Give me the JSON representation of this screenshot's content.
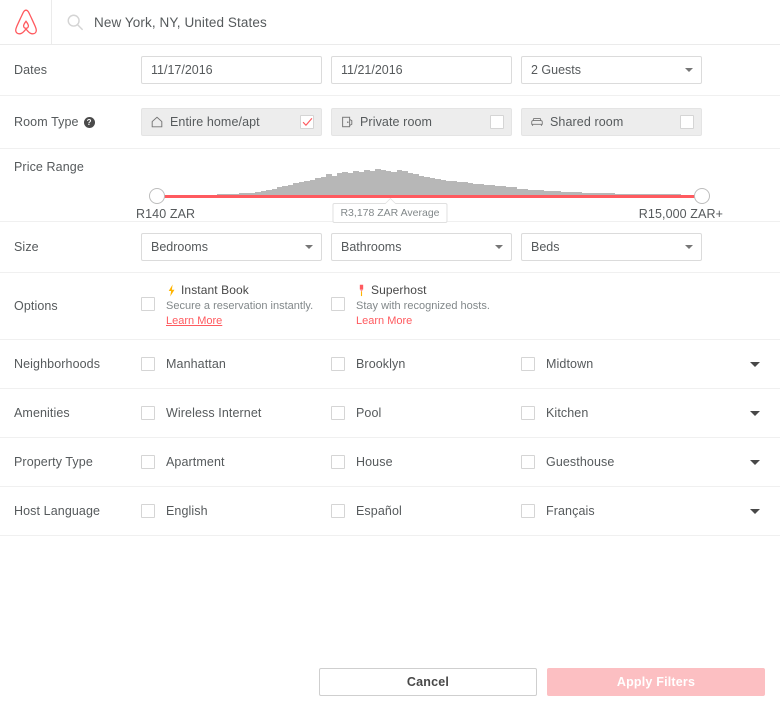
{
  "header": {
    "logo": "airbnb-logo",
    "search_icon": "search-icon",
    "search_value": "New York, NY, United States"
  },
  "dates": {
    "label": "Dates",
    "checkin": "11/17/2016",
    "checkout": "11/21/2016",
    "guests": "2 Guests"
  },
  "room_type": {
    "label": "Room Type",
    "help_icon": "question-mark-icon",
    "options": [
      {
        "label": "Entire home/apt",
        "icon": "house-icon",
        "checked": true
      },
      {
        "label": "Private room",
        "icon": "door-icon",
        "checked": false
      },
      {
        "label": "Shared room",
        "icon": "sofa-icon",
        "checked": false
      }
    ]
  },
  "price_range": {
    "label": "Price Range",
    "min": "R140 ZAR",
    "max": "R15,000 ZAR+",
    "average_tooltip": "R3,178 ZAR Average",
    "track_color": "#ff5a5f",
    "histogram_color": "#b7b7b7"
  },
  "size": {
    "label": "Size",
    "bedrooms": "Bedrooms",
    "bathrooms": "Bathrooms",
    "beds": "Beds"
  },
  "options": {
    "label": "Options",
    "items": [
      {
        "title": "Instant Book",
        "icon": "lightning-bolt-icon",
        "desc": "Secure a reservation instantly.",
        "learn_more": "Learn More",
        "checked": false
      },
      {
        "title": "Superhost",
        "icon": "medal-icon",
        "desc": "Stay with recognized hosts.",
        "learn_more": "Learn More",
        "checked": false
      }
    ]
  },
  "neighborhoods": {
    "label": "Neighborhoods",
    "items": [
      {
        "label": "Manhattan",
        "checked": false
      },
      {
        "label": "Brooklyn",
        "checked": false
      },
      {
        "label": "Midtown",
        "checked": false
      }
    ]
  },
  "amenities": {
    "label": "Amenities",
    "items": [
      {
        "label": "Wireless Internet",
        "checked": false
      },
      {
        "label": "Pool",
        "checked": false
      },
      {
        "label": "Kitchen",
        "checked": false
      }
    ]
  },
  "property_type": {
    "label": "Property Type",
    "items": [
      {
        "label": "Apartment",
        "checked": false
      },
      {
        "label": "House",
        "checked": false
      },
      {
        "label": "Guesthouse",
        "checked": false
      }
    ]
  },
  "host_language": {
    "label": "Host Language",
    "items": [
      {
        "label": "English",
        "checked": false
      },
      {
        "label": "Español",
        "checked": false
      },
      {
        "label": "Français",
        "checked": false
      }
    ]
  },
  "footer": {
    "cancel": "Cancel",
    "apply": "Apply Filters"
  },
  "chart_data": {
    "type": "bar",
    "title": "Price distribution histogram",
    "values": [
      0,
      0,
      0,
      0,
      0,
      0,
      0,
      0,
      0,
      0,
      0,
      1,
      1,
      1,
      1,
      2,
      2,
      2,
      3,
      4,
      5,
      6,
      7,
      8,
      9,
      11,
      12,
      13,
      14,
      16,
      17,
      19,
      18,
      20,
      21,
      20,
      22,
      21,
      23,
      22,
      24,
      23,
      22,
      21,
      23,
      22,
      20,
      19,
      18,
      17,
      16,
      15,
      14,
      13,
      13,
      12,
      12,
      11,
      10,
      10,
      9,
      9,
      8,
      8,
      7,
      7,
      6,
      6,
      5,
      5,
      5,
      4,
      4,
      4,
      3,
      3,
      3,
      3,
      2,
      2,
      2,
      2,
      2,
      2,
      1,
      1,
      1,
      1,
      1,
      1,
      1,
      1,
      1,
      1,
      1,
      1,
      0,
      0,
      0,
      0
    ],
    "ylim": [
      0,
      24
    ],
    "grid": false
  }
}
